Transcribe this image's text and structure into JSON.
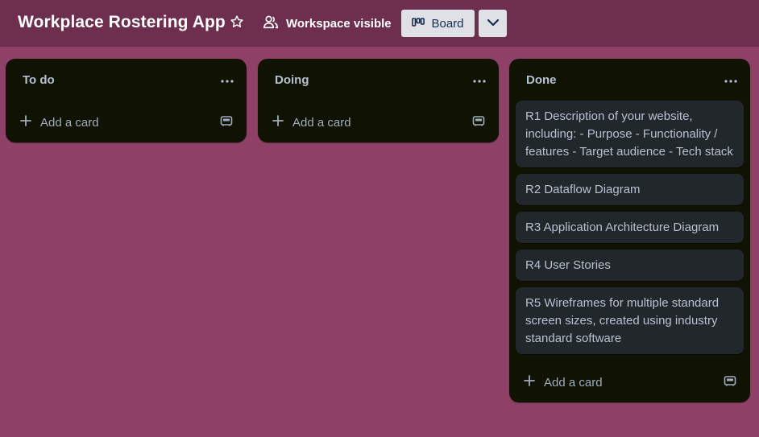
{
  "header": {
    "board_title": "Workplace Rostering App",
    "star_icon": "star-outline-icon",
    "visibility_label": "Workspace visible",
    "visibility_icon": "people-icon",
    "view_button_label": "Board",
    "view_icon": "board-columns-icon",
    "dropdown_icon": "chevron-down-icon"
  },
  "colors": {
    "background": "#8e4067",
    "header": "#6e2f4f",
    "list": "#101204",
    "card": "#22272b",
    "text": "#b6c2cf"
  },
  "lists": [
    {
      "title": "To do",
      "cards": [],
      "add_card_label": "Add a card"
    },
    {
      "title": "Doing",
      "cards": [],
      "add_card_label": "Add a card"
    },
    {
      "title": "Done",
      "cards": [
        "R1 Description of your website, including: - Purpose - Functionality / features - Target audience - Tech stack",
        "R2 Dataflow Diagram",
        "R3 Application Architecture Diagram",
        "R4 User Stories",
        "R5 Wireframes for multiple standard screen sizes, created using industry standard software"
      ],
      "add_card_label": "Add a card"
    }
  ]
}
